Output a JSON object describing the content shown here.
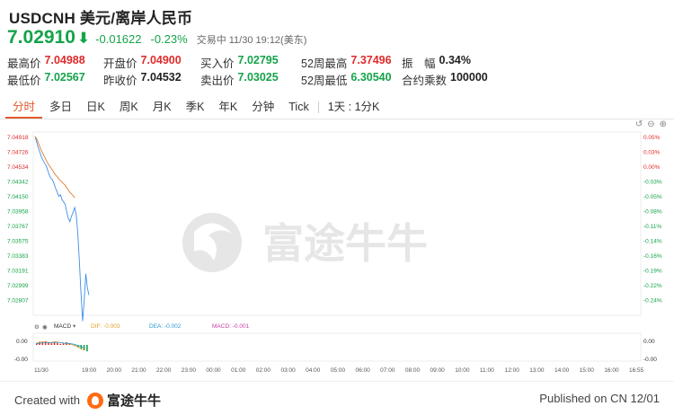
{
  "header": {
    "title": "USDCNH 美元/离岸人民币",
    "price": "7.02910",
    "arrow": "⬇",
    "change": "-0.01622",
    "change_pct": "-0.23%",
    "trade_status": "交易中 11/30 19:12(美东)"
  },
  "stats": {
    "row1": [
      {
        "label": "最高价",
        "value": "7.04988",
        "color": "red"
      },
      {
        "label": "开盘价",
        "value": "7.04900",
        "color": "red"
      },
      {
        "label": "买入价",
        "value": "7.02795",
        "color": "green"
      },
      {
        "label": "52周最高",
        "value": "7.37496",
        "color": "red"
      },
      {
        "label": "振　幅",
        "value": "0.34%",
        "color": "dark"
      }
    ],
    "row2": [
      {
        "label": "最低价",
        "value": "7.02567",
        "color": "green"
      },
      {
        "label": "昨收价",
        "value": "7.04532",
        "color": "dark"
      },
      {
        "label": "卖出价",
        "value": "7.03025",
        "color": "green"
      },
      {
        "label": "52周最低",
        "value": "6.30540",
        "color": "green"
      },
      {
        "label": "合约乘数",
        "value": "100000",
        "color": "dark"
      }
    ]
  },
  "tabs": [
    "分时",
    "多日",
    "日K",
    "周K",
    "月K",
    "季K",
    "年K",
    "分钟",
    "Tick"
  ],
  "active_tab": 0,
  "interval_label": "1天 : 1分K",
  "watermark": "富途牛牛",
  "macd": {
    "label": "MACD",
    "dif": "DIF: -0.003",
    "dea": "DEA: -0.002",
    "macd": "MACD: -0.001",
    "y_labels": [
      "0.00",
      "-0.00"
    ],
    "right_labels": [
      "0.00",
      "-0.00"
    ]
  },
  "colors": {
    "up": "#e02a2a",
    "down": "#15a34a",
    "accent": "#e0592a",
    "price_line": "#3d8ee6",
    "avg_line": "#e07b2a"
  },
  "chart_data": {
    "type": "line",
    "title": "",
    "x_ticks": [
      "11/30",
      "19:00",
      "20:00",
      "21:00",
      "22:00",
      "23:00",
      "00:00",
      "01:00",
      "02:00",
      "03:00",
      "04:00",
      "05:00",
      "06:00",
      "07:00",
      "08:00",
      "09:00",
      "10:00",
      "11:00",
      "12:00",
      "13:00",
      "14:00",
      "15:00",
      "16:00",
      "16:55"
    ],
    "y_ticks": [
      "7.04918",
      "7.04726",
      "7.04534",
      "7.04342",
      "7.04150",
      "7.03958",
      "7.03767",
      "7.03575",
      "7.03383",
      "7.03191",
      "7.02999",
      "7.02807"
    ],
    "right_ticks": [
      "0.05%",
      "0.03%",
      "0.00%",
      "-0.03%",
      "-0.05%",
      "-0.08%",
      "-0.11%",
      "-0.14%",
      "-0.16%",
      "-0.19%",
      "-0.22%",
      "-0.24%"
    ],
    "ylim": [
      7.02711,
      7.04918
    ],
    "series": [
      {
        "values": [
          7.04918,
          7.0485,
          7.0478,
          7.0472,
          7.0466,
          7.0462,
          7.0458,
          7.0455,
          7.0449,
          7.0443,
          7.0439,
          7.0437,
          7.0432,
          7.0426,
          7.0421,
          7.0416,
          7.0418,
          7.0412,
          7.0409,
          7.0406,
          7.0396,
          7.0388,
          7.0384,
          7.0391,
          7.0396,
          7.0402,
          7.0392,
          7.0368,
          7.0332,
          7.0292,
          7.0258,
          7.0285,
          7.0318,
          7.03,
          7.0291
        ]
      },
      {
        "values": [
          7.04918,
          7.0489,
          7.0484,
          7.0479,
          7.0474,
          7.047,
          7.0466,
          7.0462,
          7.0458,
          7.0455,
          7.0452,
          7.0449,
          7.0446,
          7.0443,
          7.0441,
          7.0438,
          7.0436,
          7.0434,
          7.0432,
          7.043,
          7.0427,
          7.0424,
          7.0421,
          7.0419,
          7.0417,
          7.0414
        ]
      }
    ],
    "macd_bars": [
      0.4,
      0.6,
      0.5,
      0.7,
      0.5,
      0.3,
      0.6,
      0.4,
      0.2,
      0.3,
      0.5,
      0.3,
      0.1,
      -0.2,
      -0.5,
      -0.8,
      -1.0,
      -1.2
    ],
    "macd_dif": [
      0.3,
      0.5,
      0.6,
      0.5,
      0.4,
      0.5,
      0.6,
      0.5,
      0.4,
      0.3,
      0.2,
      0.1,
      -0.1,
      -0.4,
      -0.7,
      -1.0
    ],
    "macd_dea": [
      0.2,
      0.3,
      0.4,
      0.4,
      0.4,
      0.4,
      0.5,
      0.5,
      0.4,
      0.3,
      0.3,
      0.2,
      0.1,
      -0.1,
      -0.3,
      -0.6
    ]
  },
  "footer": {
    "created_with": "Created with",
    "brand": "富途牛牛",
    "published": "Published on CN 12/01"
  }
}
